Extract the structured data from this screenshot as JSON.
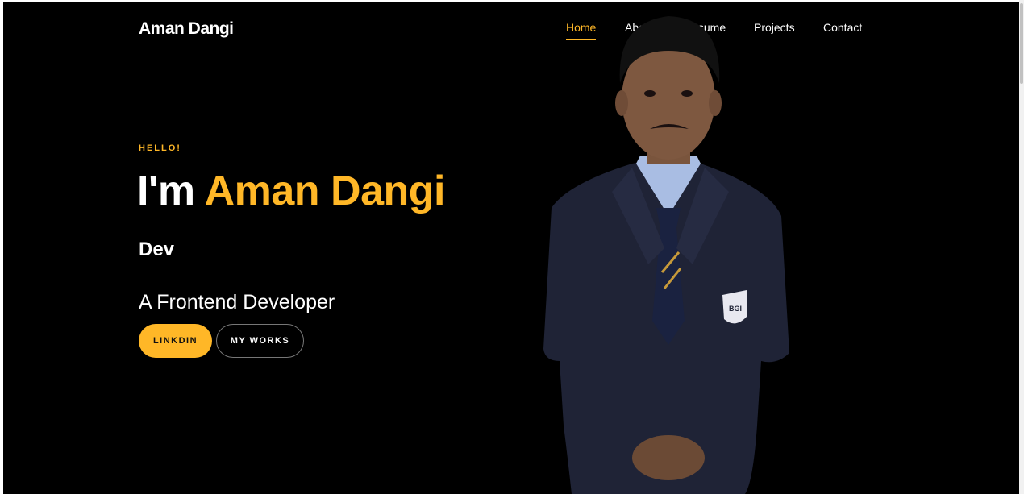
{
  "header": {
    "brand": "Aman Dangi",
    "nav": [
      {
        "label": "Home",
        "active": true
      },
      {
        "label": "About",
        "active": false
      },
      {
        "label": "Resume",
        "active": false
      },
      {
        "label": "Projects",
        "active": false
      },
      {
        "label": "Contact",
        "active": false
      }
    ]
  },
  "hero": {
    "greeting": "HELLO!",
    "headline_prefix": "I'm",
    "headline_name": "Aman Dangi",
    "subtitle": "Dev",
    "role": "A Frontend Developer",
    "buttons": {
      "primary": "LINKDIN",
      "secondary": "MY WORKS"
    }
  },
  "colors": {
    "accent": "#ffb727",
    "background": "#000000",
    "text": "#ffffff"
  }
}
